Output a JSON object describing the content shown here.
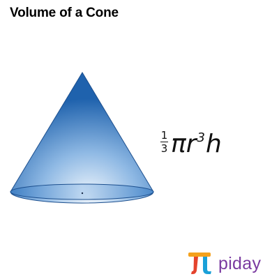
{
  "title": "Volume of a Cone",
  "formula": {
    "numerator": "1",
    "denominator": "3",
    "pi": "π",
    "r": "r",
    "exponent": "3",
    "h": "h"
  },
  "logo": {
    "text": "piday",
    "colors": {
      "orange": "#f4a11d",
      "red": "#e4432d",
      "blue": "#1aa0d8",
      "purple": "#7a3aa0"
    }
  },
  "colors": {
    "cone_dark": "#1f5fa8",
    "cone_light": "#e9f2fb",
    "background": "#ffffff"
  }
}
